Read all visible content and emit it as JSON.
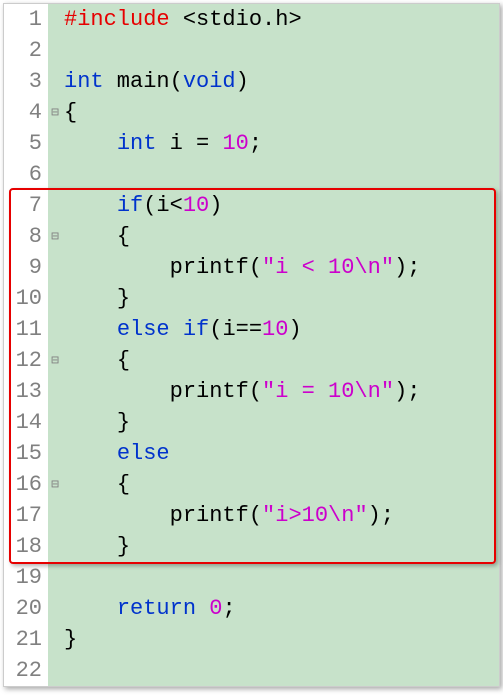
{
  "language": "c",
  "highlight": {
    "startLine": 7,
    "endLine": 18
  },
  "lines": [
    {
      "num": 1,
      "fold": "",
      "tokens": [
        [
          "preproc",
          "#include"
        ],
        [
          "ident",
          " "
        ],
        [
          "angle",
          "<stdio.h>"
        ]
      ]
    },
    {
      "num": 2,
      "fold": "",
      "tokens": []
    },
    {
      "num": 3,
      "fold": "",
      "tokens": [
        [
          "type",
          "int"
        ],
        [
          "ident",
          " main"
        ],
        [
          "punc",
          "("
        ],
        [
          "keyword",
          "void"
        ],
        [
          "punc",
          ")"
        ]
      ]
    },
    {
      "num": 4,
      "fold": "⊟",
      "tokens": [
        [
          "punc",
          "{"
        ]
      ]
    },
    {
      "num": 5,
      "fold": "",
      "tokens": [
        [
          "ident",
          "    "
        ],
        [
          "type",
          "int"
        ],
        [
          "ident",
          " i "
        ],
        [
          "punc",
          "="
        ],
        [
          "ident",
          " "
        ],
        [
          "num",
          "10"
        ],
        [
          "punc",
          ";"
        ]
      ]
    },
    {
      "num": 6,
      "fold": "",
      "tokens": []
    },
    {
      "num": 7,
      "fold": "",
      "tokens": [
        [
          "ident",
          "    "
        ],
        [
          "keyword",
          "if"
        ],
        [
          "punc",
          "("
        ],
        [
          "ident",
          "i"
        ],
        [
          "punc",
          "<"
        ],
        [
          "num",
          "10"
        ],
        [
          "punc",
          ")"
        ]
      ]
    },
    {
      "num": 8,
      "fold": "⊟",
      "tokens": [
        [
          "ident",
          "    "
        ],
        [
          "punc",
          "{"
        ]
      ]
    },
    {
      "num": 9,
      "fold": "",
      "tokens": [
        [
          "ident",
          "        printf"
        ],
        [
          "punc",
          "("
        ],
        [
          "str",
          "\"i < 10\\n\""
        ],
        [
          "punc",
          ")"
        ],
        [
          "punc",
          ";"
        ]
      ]
    },
    {
      "num": 10,
      "fold": "",
      "tokens": [
        [
          "ident",
          "    "
        ],
        [
          "punc",
          "}"
        ]
      ]
    },
    {
      "num": 11,
      "fold": "",
      "tokens": [
        [
          "ident",
          "    "
        ],
        [
          "keyword",
          "else"
        ],
        [
          "ident",
          " "
        ],
        [
          "keyword",
          "if"
        ],
        [
          "punc",
          "("
        ],
        [
          "ident",
          "i"
        ],
        [
          "punc",
          "=="
        ],
        [
          "num",
          "10"
        ],
        [
          "punc",
          ")"
        ]
      ]
    },
    {
      "num": 12,
      "fold": "⊟",
      "tokens": [
        [
          "ident",
          "    "
        ],
        [
          "punc",
          "{"
        ]
      ]
    },
    {
      "num": 13,
      "fold": "",
      "tokens": [
        [
          "ident",
          "        printf"
        ],
        [
          "punc",
          "("
        ],
        [
          "str",
          "\"i = 10\\n\""
        ],
        [
          "punc",
          ")"
        ],
        [
          "punc",
          ";"
        ]
      ]
    },
    {
      "num": 14,
      "fold": "",
      "tokens": [
        [
          "ident",
          "    "
        ],
        [
          "punc",
          "}"
        ]
      ]
    },
    {
      "num": 15,
      "fold": "",
      "tokens": [
        [
          "ident",
          "    "
        ],
        [
          "keyword",
          "else"
        ]
      ]
    },
    {
      "num": 16,
      "fold": "⊟",
      "tokens": [
        [
          "ident",
          "    "
        ],
        [
          "punc",
          "{"
        ]
      ]
    },
    {
      "num": 17,
      "fold": "",
      "tokens": [
        [
          "ident",
          "        printf"
        ],
        [
          "punc",
          "("
        ],
        [
          "str",
          "\"i>10\\n\""
        ],
        [
          "punc",
          ")"
        ],
        [
          "punc",
          ";"
        ]
      ]
    },
    {
      "num": 18,
      "fold": "",
      "tokens": [
        [
          "ident",
          "    "
        ],
        [
          "punc",
          "}"
        ]
      ]
    },
    {
      "num": 19,
      "fold": "",
      "tokens": []
    },
    {
      "num": 20,
      "fold": "",
      "tokens": [
        [
          "ident",
          "    "
        ],
        [
          "keyword",
          "return"
        ],
        [
          "ident",
          " "
        ],
        [
          "num",
          "0"
        ],
        [
          "punc",
          ";"
        ]
      ]
    },
    {
      "num": 21,
      "fold": "",
      "tokens": [
        [
          "punc",
          "}"
        ]
      ]
    },
    {
      "num": 22,
      "fold": "",
      "tokens": []
    }
  ]
}
